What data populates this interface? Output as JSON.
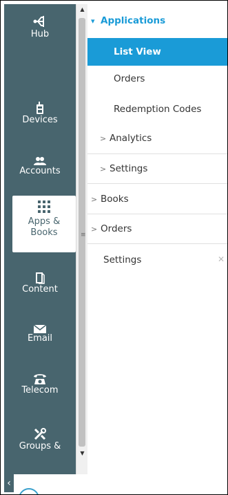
{
  "rail": {
    "items": [
      {
        "label": "Hub",
        "icon": "hub-icon"
      },
      {
        "label": "Devices",
        "icon": "device-icon"
      },
      {
        "label": "Accounts",
        "icon": "accounts-icon"
      },
      {
        "label": "Apps &\nBooks",
        "icon": "apps-grid-icon"
      },
      {
        "label": "Content",
        "icon": "content-icon"
      },
      {
        "label": "Email",
        "icon": "email-icon"
      },
      {
        "label": "Telecom",
        "icon": "telecom-icon"
      },
      {
        "label": "Groups &",
        "icon": "groups-tools-icon"
      }
    ]
  },
  "menu": {
    "applications": "Applications",
    "list_view": "List View",
    "orders_sub": "Orders",
    "redemption_codes": "Redemption Codes",
    "analytics": "Analytics",
    "settings_sub": "Settings",
    "books": "Books",
    "orders": "Orders",
    "settings": "Settings"
  },
  "colors": {
    "rail_bg": "#48656e",
    "accent": "#1a9bd7"
  }
}
